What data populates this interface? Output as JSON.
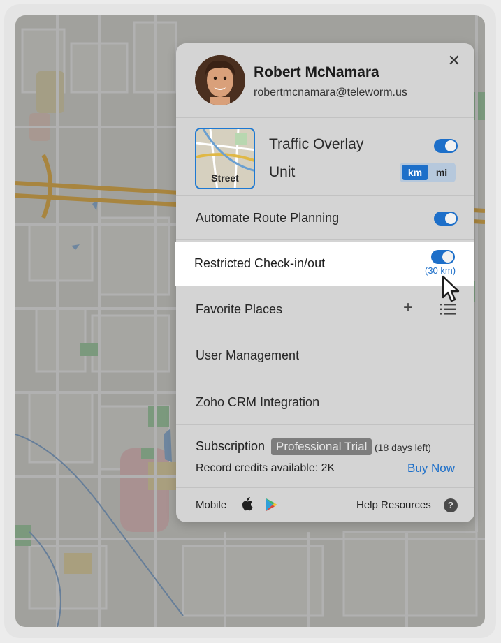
{
  "user": {
    "name": "Robert McNamara",
    "email": "robertmcnamara@teleworm.us"
  },
  "layers": {
    "thumbnail_label": "Street",
    "traffic_overlay_label": "Traffic Overlay",
    "traffic_overlay_on": true,
    "unit_label": "Unit",
    "unit_options": [
      "km",
      "mi"
    ],
    "unit_selected": "km"
  },
  "settings": {
    "automate_route_planning": {
      "label": "Automate Route Planning",
      "on": true
    },
    "restricted_checkin": {
      "label": "Restricted Check-in/out",
      "on": true,
      "distance": "(30 km)"
    },
    "favorite_places": {
      "label": "Favorite Places",
      "add_icon": "plus-icon",
      "list_icon": "list-icon"
    },
    "user_management": {
      "label": "User Management"
    },
    "crm_integration": {
      "label": "Zoho CRM Integration"
    }
  },
  "subscription": {
    "label": "Subscription",
    "plan": "Professional Trial",
    "days_left": "(18 days left)",
    "credits": "Record credits available: 2K",
    "buy_now": "Buy Now"
  },
  "footer": {
    "mobile_label": "Mobile",
    "apps": [
      "apple-icon",
      "google-play-icon"
    ],
    "help_label": "Help Resources",
    "help_icon_glyph": "?"
  },
  "colors": {
    "accent": "#1d6fc9",
    "highlight_bg": "#ffffff",
    "panel_bg": "#d4d4d4",
    "badge_bg": "#7d7d7d"
  }
}
